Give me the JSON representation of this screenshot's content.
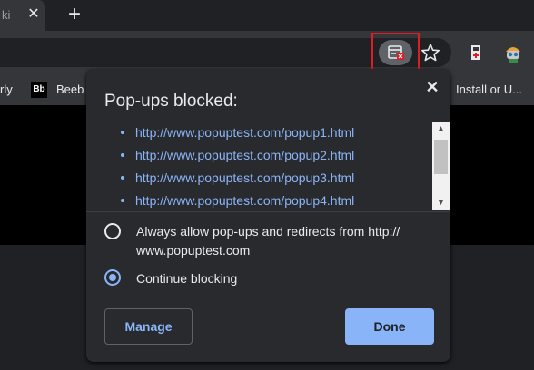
{
  "tab": {
    "title": "ki",
    "close_glyph": "✕"
  },
  "new_tab_glyph": "+",
  "toolbar": {
    "popup_blocked_icon": "popup-blocked-icon",
    "star_icon": "star-icon",
    "extension_icon": "extension-icon",
    "avatar_icon": "avatar-icon",
    "highlight_color": "#e01c24"
  },
  "bookmarks": {
    "left_partial": "rly",
    "beeb_icon": "Bb",
    "beeb_label": "Beeb",
    "right_partial": "Install or U..."
  },
  "bubble": {
    "title": "Pop-ups blocked:",
    "close_glyph": "✕",
    "popups": [
      "http://www.popuptest.com/popup1.html",
      "http://www.popuptest.com/popup2.html",
      "http://www.popuptest.com/popup3.html",
      "http://www.popuptest.com/popup4.html"
    ],
    "scroll_up_glyph": "▲",
    "scroll_down_glyph": "▼",
    "options": [
      {
        "label": "Always allow pop-ups and redirects from http://\nwww.popuptest.com",
        "checked": false
      },
      {
        "label": "Continue blocking",
        "checked": true
      }
    ],
    "manage_label": "Manage",
    "done_label": "Done",
    "accent_color": "#8ab4f8"
  }
}
